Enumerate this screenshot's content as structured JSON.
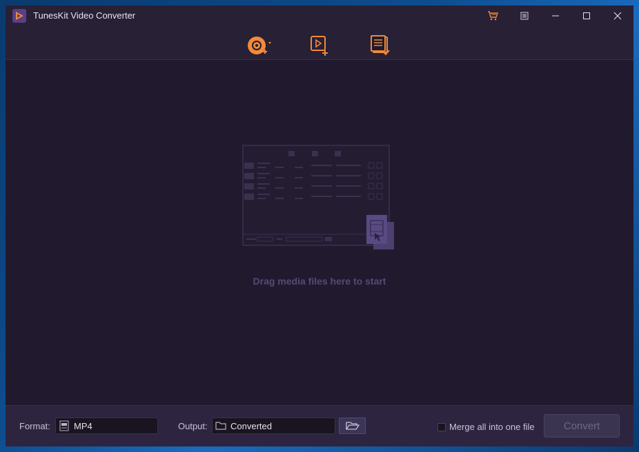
{
  "window": {
    "title": "TunesKit Video Converter"
  },
  "titlebar": {
    "icons": [
      "cart-icon",
      "menu-icon",
      "minimize-icon",
      "maximize-icon",
      "close-icon"
    ]
  },
  "toolbar": {
    "icons": [
      "load-disc-icon",
      "add-files-icon",
      "converted-history-icon"
    ]
  },
  "main": {
    "drop_hint": "Drag media files here to start"
  },
  "bottom": {
    "format_label": "Format:",
    "format_value": "MP4",
    "output_label": "Output:",
    "output_value": "Converted",
    "merge_label": "Merge all into one file",
    "merge_checked": false,
    "convert_label": "Convert"
  },
  "colors": {
    "accent": "#f08a3a",
    "background": "#211a2e",
    "bar": "#282035",
    "drop_text": "#574a74"
  }
}
